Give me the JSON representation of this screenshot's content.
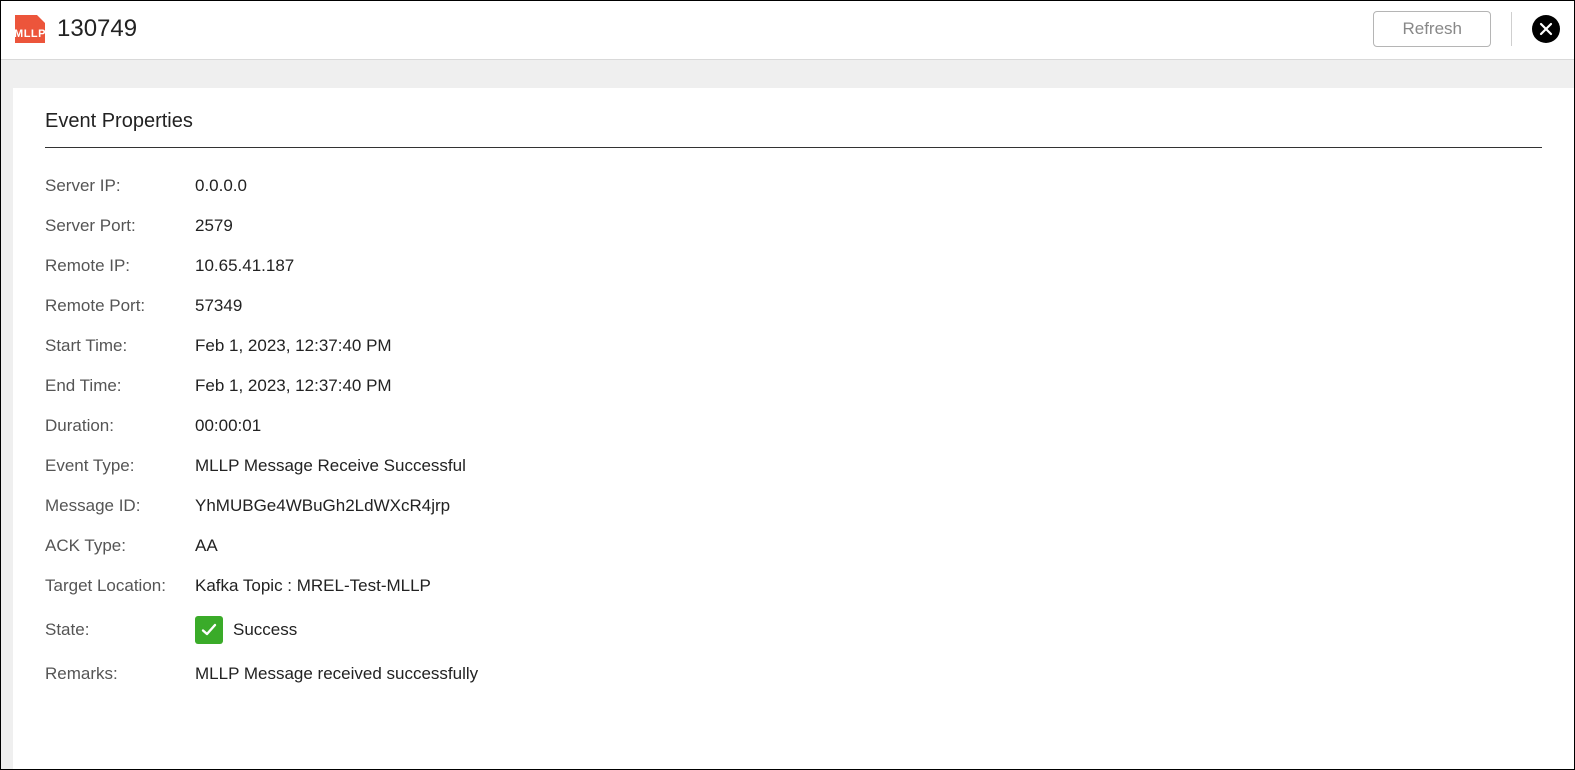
{
  "header": {
    "badge": "MLLP",
    "title": "130749",
    "refresh_label": "Refresh"
  },
  "section": {
    "title": "Event Properties"
  },
  "props": {
    "server_ip": {
      "label": "Server IP:",
      "value": "0.0.0.0"
    },
    "server_port": {
      "label": "Server Port:",
      "value": "2579"
    },
    "remote_ip": {
      "label": "Remote IP:",
      "value": "10.65.41.187"
    },
    "remote_port": {
      "label": "Remote Port:",
      "value": "57349"
    },
    "start_time": {
      "label": "Start Time:",
      "value": "Feb 1, 2023, 12:37:40 PM"
    },
    "end_time": {
      "label": "End Time:",
      "value": "Feb 1, 2023, 12:37:40 PM"
    },
    "duration": {
      "label": "Duration:",
      "value": "00:00:01"
    },
    "event_type": {
      "label": "Event Type:",
      "value": "MLLP Message Receive Successful"
    },
    "message_id": {
      "label": "Message ID:",
      "value": "YhMUBGe4WBuGh2LdWXcR4jrp"
    },
    "ack_type": {
      "label": "ACK Type:",
      "value": "AA"
    },
    "target_location": {
      "label": "Target Location:",
      "value": "Kafka Topic : MREL-Test-MLLP"
    },
    "state": {
      "label": "State:",
      "value": "Success"
    },
    "remarks": {
      "label": "Remarks:",
      "value": "MLLP Message received successfully"
    }
  },
  "colors": {
    "badge_bg": "#ec553b",
    "success_bg": "#3aab29"
  }
}
